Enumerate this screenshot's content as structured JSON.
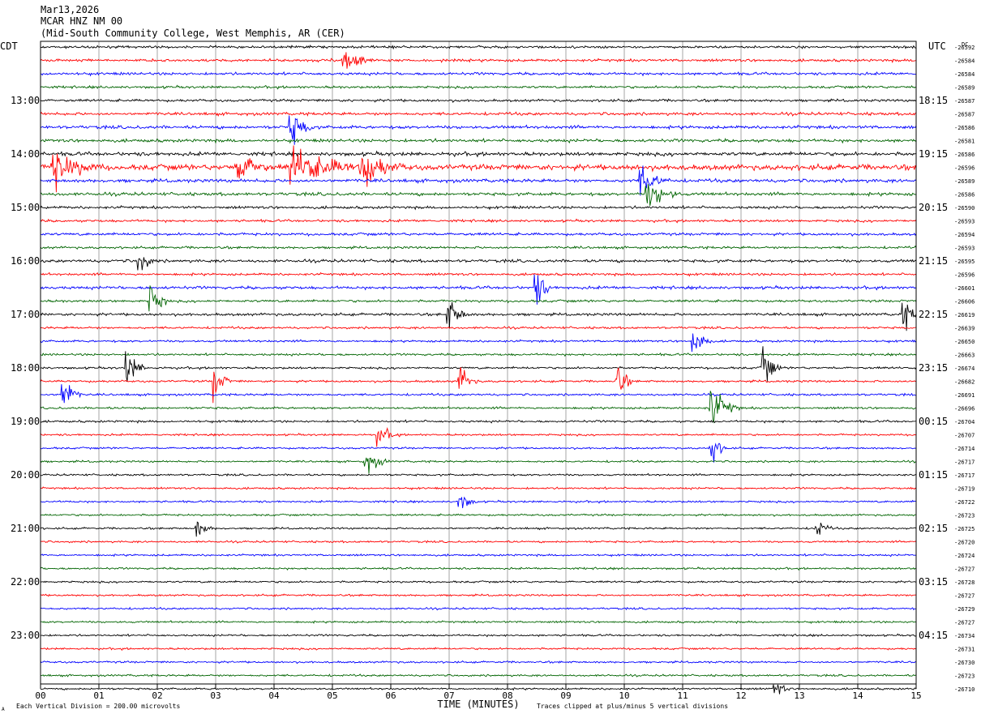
{
  "header": {
    "date": "Mar13,2026",
    "channel": "MCAR HNZ NM 00",
    "location": "(Mid-South Community College, West Memphis, AR (CER)"
  },
  "left_tz": "CDT",
  "right_tz": "UTC",
  "dc_label": "DC",
  "x_axis_label": "TIME (MINUTES)",
  "footer_left": "Each Vertical Division =  200.00 microvolts",
  "footer_right": "Traces clipped at plus/minus 5 vertical divisions",
  "footer_mark": "A",
  "colors": [
    "#000000",
    "#ff0000",
    "#0000ff",
    "#006400"
  ],
  "chart_data": {
    "type": "line",
    "title": "Mar13,2026 MCAR HNZ NM 00",
    "xlabel": "TIME (MINUTES)",
    "x_ticks": [
      "00",
      "01",
      "02",
      "03",
      "04",
      "05",
      "06",
      "07",
      "08",
      "09",
      "10",
      "11",
      "12",
      "13",
      "14",
      "15"
    ],
    "xlim": [
      0,
      15
    ],
    "rows_per_hour": 4,
    "left_hour_labels": [
      "13:00",
      "14:00",
      "15:00",
      "16:00",
      "17:00",
      "18:00",
      "19:00",
      "20:00",
      "21:00",
      "22:00",
      "23:00"
    ],
    "right_hour_labels": [
      "18:15",
      "19:15",
      "20:15",
      "21:15",
      "22:15",
      "23:15",
      "00:15",
      "01:15",
      "02:15",
      "03:15",
      "04:15"
    ],
    "dc_offsets": [
      -26592,
      -26584,
      -26584,
      -26589,
      -26587,
      -26587,
      -26586,
      -26581,
      -26586,
      -26596,
      -26589,
      -26586,
      -26590,
      -26593,
      -26594,
      -26593,
      -26595,
      -26596,
      -26601,
      -26606,
      -26619,
      -26639,
      -26650,
      -26663,
      -26674,
      -26682,
      -26691,
      -26696,
      -26704,
      -26707,
      -26714,
      -26717,
      -26717,
      -26719,
      -26722,
      -26723,
      -26725,
      -26720,
      -26724,
      -26727,
      -26728,
      -26727,
      -26729,
      -26727,
      -26734,
      -26731,
      -26730,
      -26723,
      -26710
    ],
    "trace_amplitude_divisions": [
      2.0,
      2.2,
      2.2,
      2.0,
      2.1,
      2.4,
      2.6,
      2.6,
      3.0,
      4.5,
      2.8,
      2.6,
      2.2,
      2.0,
      2.2,
      2.0,
      2.4,
      2.0,
      2.4,
      2.0,
      2.2,
      1.8,
      1.8,
      1.8,
      1.8,
      1.8,
      1.8,
      1.8,
      1.8,
      1.6,
      1.6,
      1.6,
      1.6,
      1.6,
      1.6,
      1.6,
      1.6,
      1.6,
      1.6,
      1.6,
      1.6,
      1.6,
      1.6,
      1.6,
      1.6,
      1.6,
      1.6,
      1.6,
      1.6
    ],
    "events": [
      {
        "row": 9,
        "minute": 0.2,
        "amp_divisions": 5,
        "duration_min": 1.0
      },
      {
        "row": 9,
        "minute": 3.4,
        "amp_divisions": 5,
        "duration_min": 0.6
      },
      {
        "row": 9,
        "minute": 4.3,
        "amp_divisions": 5,
        "duration_min": 1.6
      },
      {
        "row": 9,
        "minute": 5.5,
        "amp_divisions": 5,
        "duration_min": 0.9
      },
      {
        "row": 1,
        "minute": 5.2,
        "amp_divisions": 5,
        "duration_min": 0.5
      },
      {
        "row": 6,
        "minute": 4.3,
        "amp_divisions": 5,
        "duration_min": 0.4
      },
      {
        "row": 10,
        "minute": 10.3,
        "amp_divisions": 4,
        "duration_min": 0.5
      },
      {
        "row": 11,
        "minute": 10.4,
        "amp_divisions": 4,
        "duration_min": 0.6
      },
      {
        "row": 16,
        "minute": 1.7,
        "amp_divisions": 4,
        "duration_min": 0.3
      },
      {
        "row": 18,
        "minute": 8.5,
        "amp_divisions": 5,
        "duration_min": 0.3
      },
      {
        "row": 19,
        "minute": 1.9,
        "amp_divisions": 5,
        "duration_min": 0.3
      },
      {
        "row": 20,
        "minute": 7.0,
        "amp_divisions": 4,
        "duration_min": 0.4
      },
      {
        "row": 20,
        "minute": 14.8,
        "amp_divisions": 4,
        "duration_min": 0.3
      },
      {
        "row": 22,
        "minute": 11.2,
        "amp_divisions": 5,
        "duration_min": 0.3
      },
      {
        "row": 24,
        "minute": 1.5,
        "amp_divisions": 5,
        "duration_min": 0.3
      },
      {
        "row": 24,
        "minute": 12.4,
        "amp_divisions": 5,
        "duration_min": 0.3
      },
      {
        "row": 25,
        "minute": 3.0,
        "amp_divisions": 4,
        "duration_min": 0.3
      },
      {
        "row": 25,
        "minute": 7.2,
        "amp_divisions": 4,
        "duration_min": 0.3
      },
      {
        "row": 25,
        "minute": 9.9,
        "amp_divisions": 4,
        "duration_min": 0.3
      },
      {
        "row": 26,
        "minute": 0.4,
        "amp_divisions": 5,
        "duration_min": 0.3
      },
      {
        "row": 27,
        "minute": 11.5,
        "amp_divisions": 5,
        "duration_min": 0.5
      },
      {
        "row": 29,
        "minute": 5.8,
        "amp_divisions": 2.5,
        "duration_min": 0.4
      },
      {
        "row": 30,
        "minute": 11.5,
        "amp_divisions": 4,
        "duration_min": 0.3
      },
      {
        "row": 31,
        "minute": 5.6,
        "amp_divisions": 3,
        "duration_min": 0.4
      },
      {
        "row": 34,
        "minute": 7.2,
        "amp_divisions": 2.5,
        "duration_min": 0.3
      },
      {
        "row": 36,
        "minute": 2.7,
        "amp_divisions": 2.5,
        "duration_min": 0.3
      },
      {
        "row": 36,
        "minute": 13.3,
        "amp_divisions": 2.5,
        "duration_min": 0.3
      },
      {
        "row": 48,
        "minute": 12.6,
        "amp_divisions": 2,
        "duration_min": 0.3
      }
    ]
  }
}
